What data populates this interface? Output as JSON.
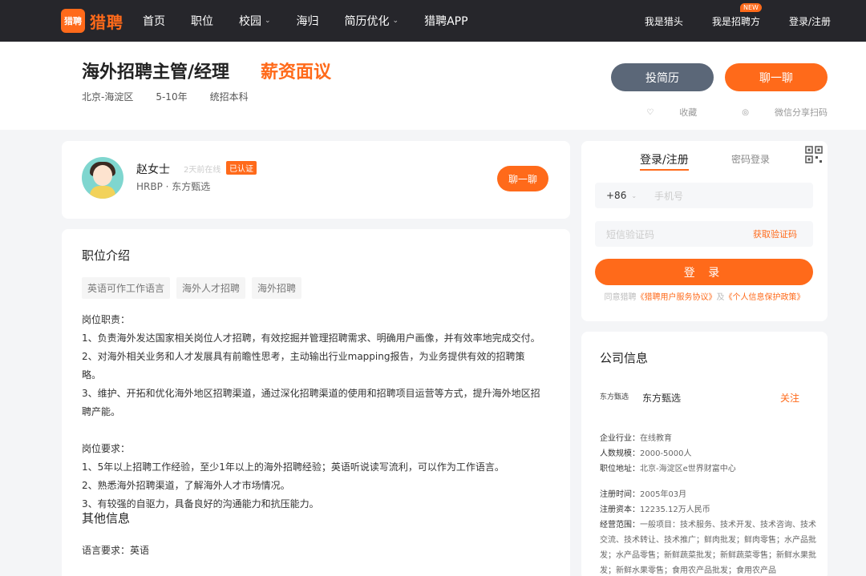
{
  "nav": {
    "logo_mark": "猎聘",
    "logo_text": "猎聘",
    "links": [
      "首页",
      "职位",
      "校园",
      "海归",
      "简历优化",
      "猎聘APP"
    ],
    "right": [
      "我是猎头",
      "我是招聘方",
      "登录/注册"
    ],
    "new_badge": "NEW"
  },
  "job": {
    "title": "海外招聘主管/经理",
    "salary": "薪资面议",
    "meta": [
      "北京-海淀区",
      "5-10年",
      "统招本科"
    ],
    "apply_label": "投简历",
    "chat_label": "聊一聊",
    "favorite": "收藏",
    "share": "微信分享扫码"
  },
  "recruiter": {
    "name": "赵女士",
    "online": "2天前在线",
    "badge": "已认证",
    "role": "HRBP · 东方甄选",
    "chat_label": "聊一聊"
  },
  "detail": {
    "title": "职位介绍",
    "tags": [
      "英语可作工作语言",
      "海外人才招聘",
      "海外招聘"
    ],
    "lines": [
      "岗位职责：",
      "1、负责海外发达国家相关岗位人才招聘，有效挖掘并管理招聘需求、明确用户画像，并有效率地完成交付。",
      "2、对海外相关业务和人才发展具有前瞻性思考，主动输出行业mapping报告，为业务提供有效的招聘策略。",
      "3、维护、开拓和优化海外地区招聘渠道，通过深化招聘渠道的使用和招聘项目运营等方式，提升海外地区招聘产能。",
      "",
      "岗位要求：",
      "1、5年以上招聘工作经验，至少1年以上的海外招聘经验；英语听说读写流利，可以作为工作语言。",
      "2、熟悉海外招聘渠道，了解海外人才市场情况。",
      "3、有较强的自驱力，具备良好的沟通能力和抗压能力。"
    ],
    "other_title": "其他信息",
    "other_line": "语言要求：英语"
  },
  "login": {
    "tab_register": "登录/注册",
    "tab_password": "密码登录",
    "country_code": "+86",
    "phone_placeholder": "手机号",
    "code_placeholder": "短信验证码",
    "get_code": "获取验证码",
    "submit": "登 录",
    "agree_prefix": "同意猎聘",
    "agree_link1": "《猎聘用户服务协议》",
    "agree_and": "及",
    "agree_link2": "《个人信息保护政策》"
  },
  "company": {
    "title": "公司信息",
    "logo_text": "东方甄选",
    "name": "东方甄选",
    "follow": "关注",
    "industry_k": "企业行业：",
    "industry_v": "在线教育",
    "size_k": "人数规模：",
    "size_v": "2000-5000人",
    "addr_k": "职位地址：",
    "addr_v": "北京-海淀区e世界财富中心",
    "reg_time_k": "注册时间：",
    "reg_time_v": "2005年03月",
    "capital_k": "注册资本：",
    "capital_v": "12235.12万人民币",
    "scope_k": "经营范围：",
    "scope_v": "一般项目：技术服务、技术开发、技术咨询、技术交流、技术转让、技术推广；鲜肉批发；鲜肉零售；水产品批发；水产品零售；新鲜蔬菜批发；新鲜蔬菜零售；新鲜水果批发；新鲜水果零售；食用农产品批发；食用农产品"
  },
  "colors": {
    "accent": "#ff6a1a",
    "nav_bg": "#26262b",
    "apply_btn": "#5b6778"
  }
}
